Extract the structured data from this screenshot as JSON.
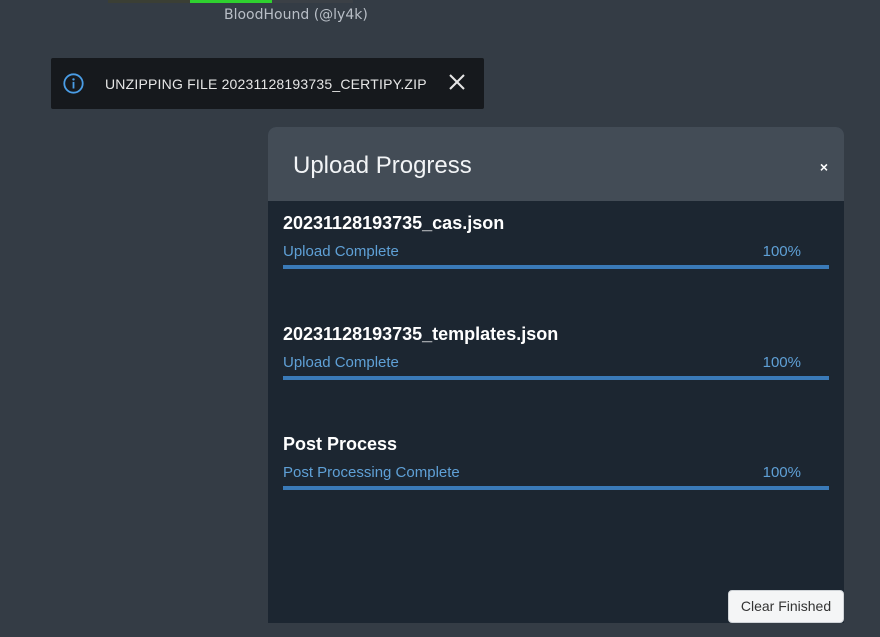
{
  "credit": "BloodHound (@ly4k)",
  "toast": {
    "icon": "info-icon",
    "message": "UNZIPPING FILE 20231128193735_CERTIPY.ZIP",
    "close_icon": "close-icon"
  },
  "modal": {
    "title": "Upload Progress",
    "close_label": "×",
    "items": [
      {
        "name": "20231128193735_cas.json",
        "status": "Upload Complete",
        "percent_label": "100%",
        "progress": 1.0
      },
      {
        "name": "20231128193735_templates.json",
        "status": "Upload Complete",
        "percent_label": "100%",
        "progress": 1.0
      },
      {
        "name": "Post Process",
        "status": "Post Processing Complete",
        "percent_label": "100%",
        "progress": 1.0
      }
    ],
    "clear_button_label": "Clear Finished"
  },
  "colors": {
    "background": "#343c45",
    "modal_body": "#1c2631",
    "modal_header": "#434c56",
    "accent": "#3a7ab8",
    "status_text": "#5fa0d6",
    "toast_bg": "#16191d",
    "info_icon": "#4a9de6"
  }
}
